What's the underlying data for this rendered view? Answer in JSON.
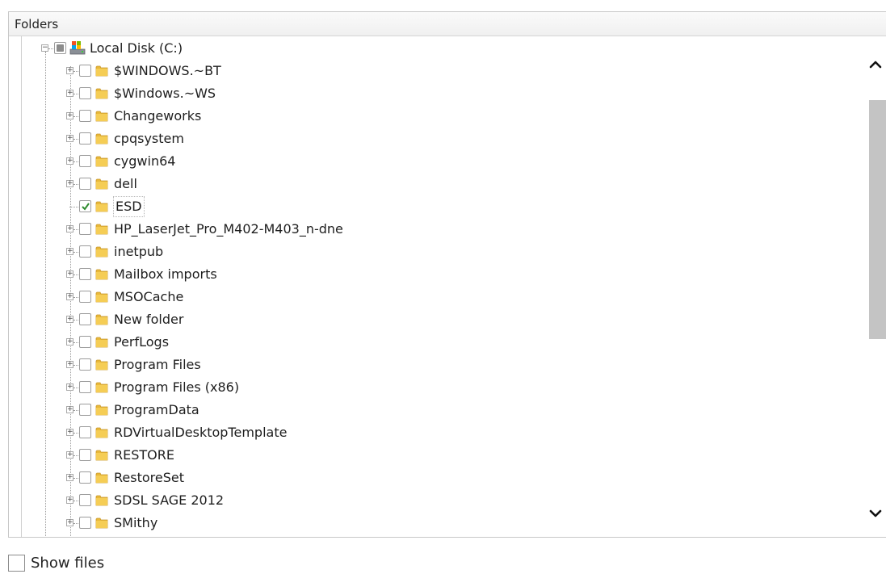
{
  "panel": {
    "title": "Folders"
  },
  "drive": {
    "label": "Local Disk (C:)",
    "icon": "drive-icon",
    "check_state": "partial",
    "expanded": true
  },
  "folders": [
    {
      "label": "$WINDOWS.~BT",
      "checked": false,
      "expandable": true
    },
    {
      "label": "$Windows.~WS",
      "checked": false,
      "expandable": true
    },
    {
      "label": "Changeworks",
      "checked": false,
      "expandable": true
    },
    {
      "label": "cpqsystem",
      "checked": false,
      "expandable": true
    },
    {
      "label": "cygwin64",
      "checked": false,
      "expandable": true
    },
    {
      "label": "dell",
      "checked": false,
      "expandable": true
    },
    {
      "label": "ESD",
      "checked": true,
      "expandable": false,
      "selected": true
    },
    {
      "label": "HP_LaserJet_Pro_M402-M403_n-dne",
      "checked": false,
      "expandable": true
    },
    {
      "label": "inetpub",
      "checked": false,
      "expandable": true
    },
    {
      "label": "Mailbox imports",
      "checked": false,
      "expandable": true
    },
    {
      "label": "MSOCache",
      "checked": false,
      "expandable": true
    },
    {
      "label": "New folder",
      "checked": false,
      "expandable": true
    },
    {
      "label": "PerfLogs",
      "checked": false,
      "expandable": true
    },
    {
      "label": "Program Files",
      "checked": false,
      "expandable": true
    },
    {
      "label": "Program Files (x86)",
      "checked": false,
      "expandable": true
    },
    {
      "label": "ProgramData",
      "checked": false,
      "expandable": true
    },
    {
      "label": "RDVirtualDesktopTemplate",
      "checked": false,
      "expandable": true
    },
    {
      "label": "RESTORE",
      "checked": false,
      "expandable": true
    },
    {
      "label": "RestoreSet",
      "checked": false,
      "expandable": true
    },
    {
      "label": "SDSL SAGE 2012",
      "checked": false,
      "expandable": true
    },
    {
      "label": "SMithy",
      "checked": false,
      "expandable": true
    }
  ],
  "scrollbar": {
    "up_icon": "chevron-up-icon",
    "down_icon": "chevron-down-icon"
  },
  "show_files": {
    "label": "Show files",
    "checked": false
  },
  "colors": {
    "folder": "#e8b83a",
    "check_green": "#2e8b2e",
    "thumb": "#c4c4c4"
  }
}
